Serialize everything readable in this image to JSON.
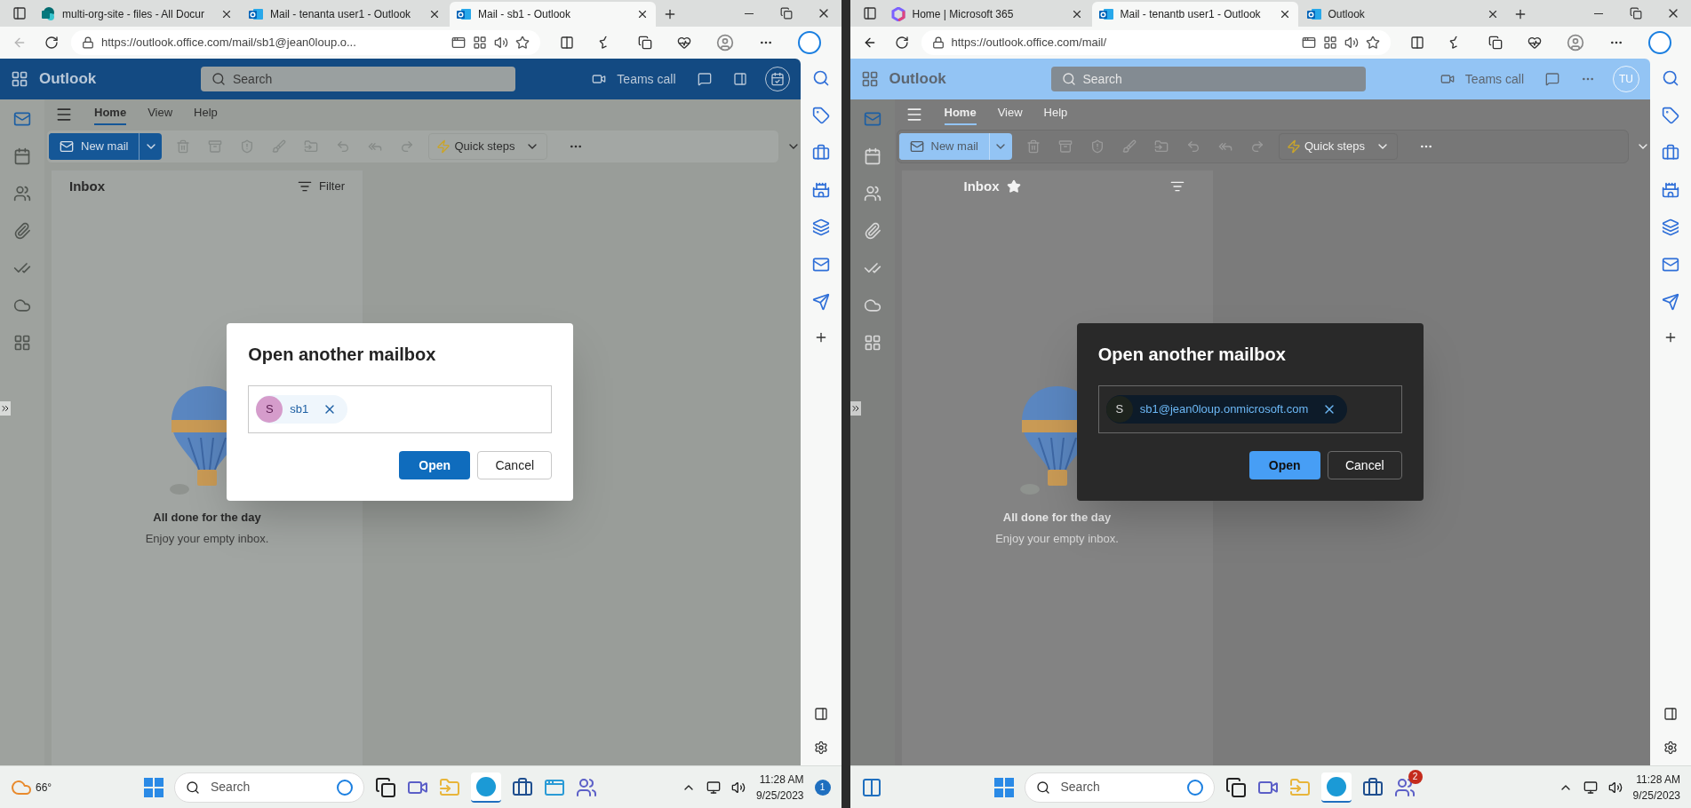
{
  "screens": [
    {
      "dark_mode": false,
      "back_enabled": false,
      "browser_tabs": [
        {
          "kind": "sharepoint",
          "title": "multi-org-site - files - All Docur",
          "selected": false
        },
        {
          "kind": "outlook",
          "title": "Mail - tenanta user1 - Outlook",
          "selected": false
        },
        {
          "kind": "outlook",
          "title": "Mail - sb1 - Outlook",
          "selected": true
        }
      ],
      "address": "https://outlook.office.com/mail/sb1@jean0loup.o...",
      "app": {
        "name": "Outlook",
        "search_placeholder": "Search",
        "teams_call": "Teams call"
      },
      "ribbon_tabs": [
        {
          "label": "Home",
          "selected": true
        },
        {
          "label": "View",
          "selected": false
        },
        {
          "label": "Help",
          "selected": false
        }
      ],
      "new_mail": "New mail",
      "quick_steps": "Quick steps",
      "folder": {
        "title": "Inbox",
        "favorite": false,
        "filter": "Filter"
      },
      "empty": {
        "title": "All done for the day",
        "subtitle": "Enjoy your empty inbox."
      },
      "dialog": {
        "title": "Open another mailbox",
        "chip_initial": "S",
        "chip_label": "sb1",
        "open": "Open",
        "cancel": "Cancel"
      },
      "taskbar": {
        "weather": "66°",
        "search": "Search",
        "time": "11:28 AM",
        "date": "9/25/2023",
        "notifications": "1"
      }
    },
    {
      "dark_mode": true,
      "back_enabled": true,
      "browser_tabs": [
        {
          "kind": "m365",
          "title": "Home | Microsoft 365",
          "selected": false
        },
        {
          "kind": "outlook",
          "title": "Mail - tenantb user1 - Outlook",
          "selected": true
        },
        {
          "kind": "outlook",
          "title": "Outlook",
          "selected": false
        }
      ],
      "address": "https://outlook.office.com/mail/",
      "app": {
        "name": "Outlook",
        "search_placeholder": "Search",
        "teams_call": "Teams call",
        "avatar": "TU"
      },
      "ribbon_tabs": [
        {
          "label": "Home",
          "selected": true
        },
        {
          "label": "View",
          "selected": false
        },
        {
          "label": "Help",
          "selected": false
        }
      ],
      "new_mail": "New mail",
      "quick_steps": "Quick steps",
      "folder": {
        "title": "Inbox",
        "favorite": true
      },
      "empty": {
        "title": "All done for the day",
        "subtitle": "Enjoy your empty inbox."
      },
      "dialog": {
        "title": "Open another mailbox",
        "chip_initial": "S",
        "chip_label": "sb1@jean0loup.onmicrosoft.com",
        "open": "Open",
        "cancel": "Cancel"
      },
      "taskbar": {
        "search": "Search",
        "time": "11:28 AM",
        "date": "9/25/2023",
        "teams_badge": "2"
      }
    }
  ]
}
